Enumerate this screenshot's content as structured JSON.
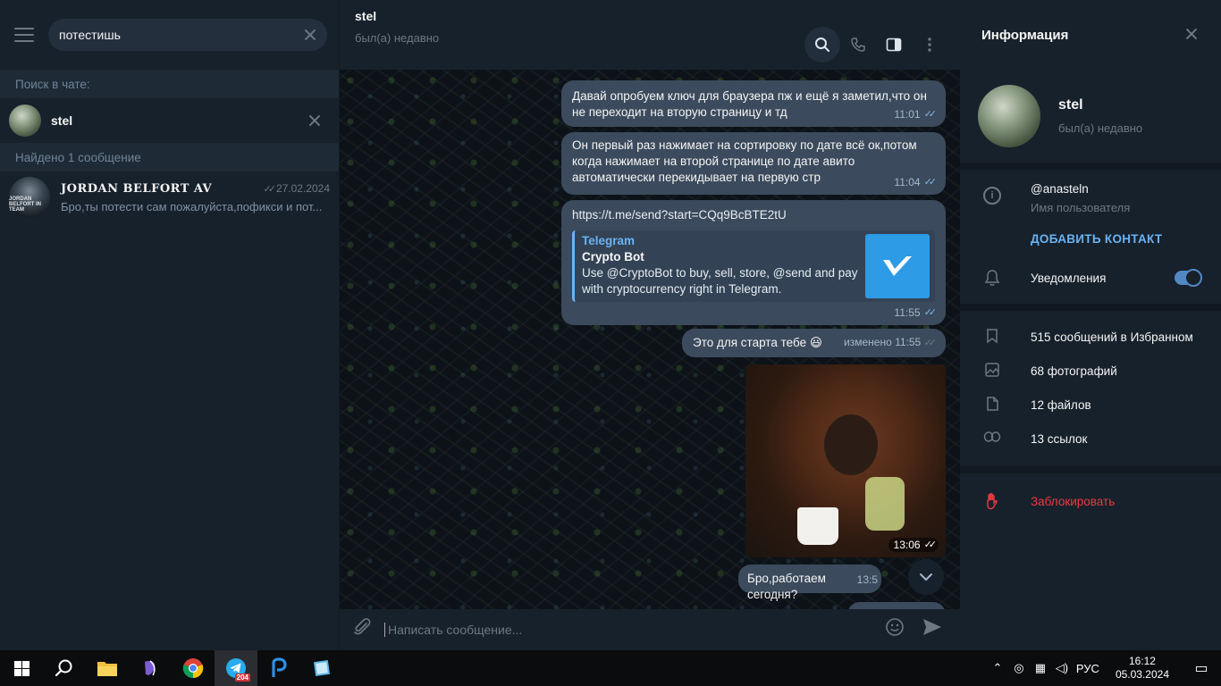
{
  "left": {
    "search_value": "потестишь",
    "in_chat_label": "Поиск в чате:",
    "in_chat_name": "stel",
    "found_label": "Найдено 1 сообщение",
    "result": {
      "avatar_text": "JORDAN BELFORT IN TEAM",
      "title": "JORDAN BELFORT AV",
      "date": "27.02.2024",
      "preview": "Бро,ты потести сам пожалуйста,пофикси и пот..."
    }
  },
  "chat": {
    "name": "stel",
    "status": "был(а) недавно",
    "messages": [
      {
        "text": "Давай опробуем ключ для браузера пж и ещё я заметил,что он не переходит на вторую страницу и тд",
        "time": "11:01"
      },
      {
        "text": "Он первый раз нажимает на сортировку по дате всё ок,потом когда нажимает на второй странице по дате авито автоматически перекидывает на первую стр",
        "time": "11:04"
      },
      {
        "link": "https://t.me/send?start=CQq9BcBTE2tU",
        "site": "Telegram",
        "title": "Crypto Bot",
        "desc": "Use @CryptoBot to buy, sell, store, @send and pay with cryptocurrency right in Telegram.",
        "time": "11:55"
      },
      {
        "text": "Это для старта тебе 😃",
        "edited": "изменено 11:55"
      },
      {
        "photo_time": "13:06"
      },
      {
        "text": "Бро,работаем сегодня?",
        "time": "13:5"
      }
    ],
    "composer_placeholder": "Написать сообщение..."
  },
  "right": {
    "title": "Информация",
    "name": "stel",
    "status": "был(а) недавно",
    "username": "@anasteln",
    "username_label": "Имя пользователя",
    "add_contact": "ДОБАВИТЬ КОНТАКТ",
    "notifications": "Уведомления",
    "notifications_on": true,
    "stats": [
      {
        "icon": "bookmark-icon",
        "label": "515 сообщений в Избранном"
      },
      {
        "icon": "photo-icon",
        "label": "68 фотографий"
      },
      {
        "icon": "file-icon",
        "label": "12 файлов"
      },
      {
        "icon": "link-icon",
        "label": "13 ссылок"
      }
    ],
    "block": "Заблокировать"
  },
  "taskbar": {
    "telegram_badge": "204",
    "language": "РУС",
    "time": "16:12",
    "date": "05.03.2024"
  },
  "colors": {
    "bg": "#17212b",
    "bubble": "#3b4a5c",
    "accent": "#6ab3f3",
    "danger": "#ec3942"
  }
}
